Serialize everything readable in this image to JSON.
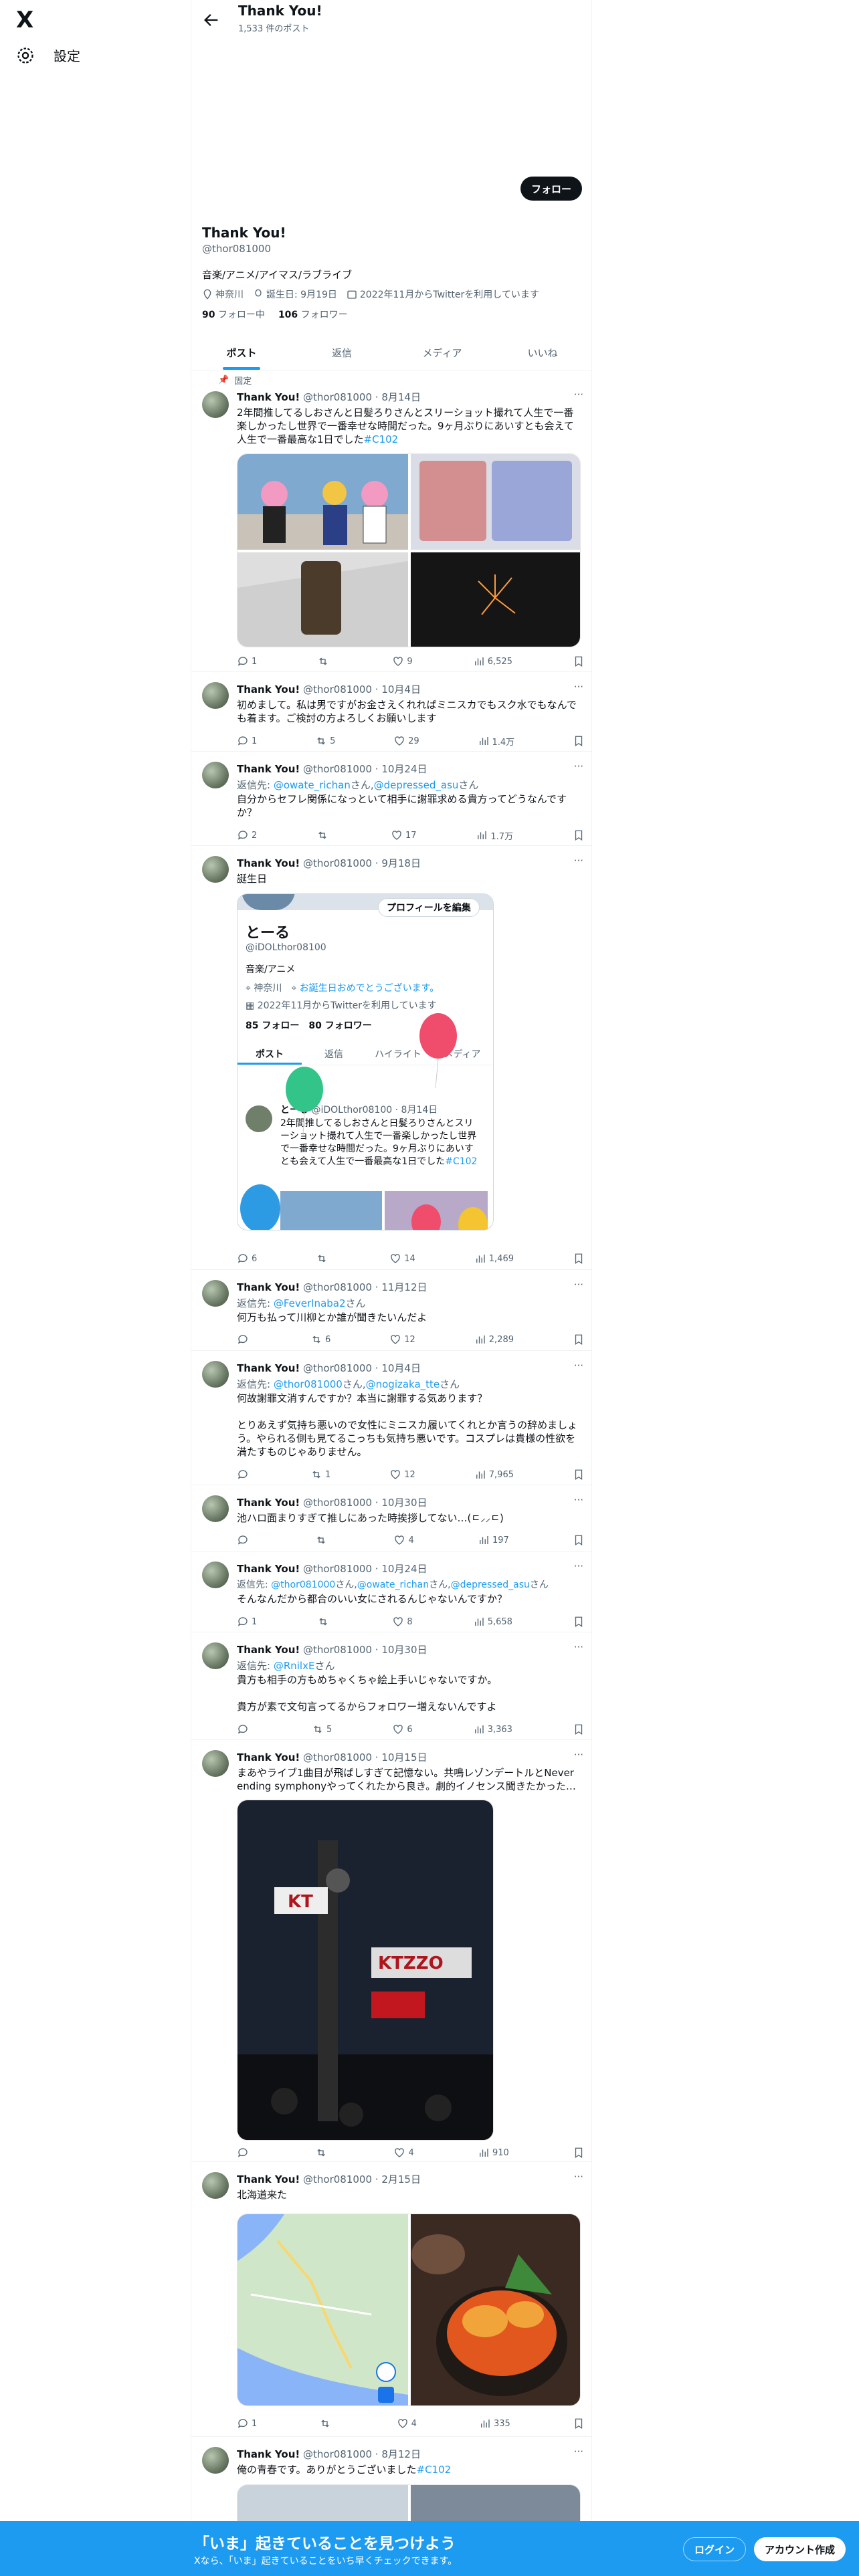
{
  "nav": {
    "logo": "X",
    "settings_label": "設定"
  },
  "header": {
    "name": "Thank You!",
    "post_count": "1,533 件のポスト"
  },
  "profile": {
    "follow_button": "フォロー",
    "name": "Thank You!",
    "handle": "@thor081000",
    "bio": "音楽/アニメ/アイマス/ラブライブ",
    "location": "神奈川",
    "birthday": "誕生日: 9月19日",
    "joined": "2022年11月からTwitterを利用しています",
    "following_count": "90",
    "following_label": "フォロー中",
    "followers_count": "106",
    "followers_label": "フォロワー"
  },
  "tabs": [
    "ポスト",
    "返信",
    "メディア",
    "いいね"
  ],
  "pinned_label": "固定",
  "tweets": [
    {
      "name": "Thank You!",
      "handle": "@thor081000",
      "date": "8月14日",
      "text": "2年間推してるしおさんと日髪ろりさんとスリーショット撮れて人生で一番楽しかったし世界で一番幸せな時間だった。9ヶ月ぶりにあいすとも会えて人生で一番最高な1日でした",
      "hashtag": "#C102",
      "reply": "1",
      "retweet": "",
      "like": "9",
      "views": "6,525"
    },
    {
      "name": "Thank You!",
      "handle": "@thor081000",
      "date": "10月4日",
      "text": "初めまして。私は男ですがお金さえくれればミニスカでもスク水でもなんでも着ます。ご検討の方よろしくお願いします",
      "reply": "1",
      "retweet": "5",
      "like": "29",
      "views": "1.4万"
    },
    {
      "name": "Thank You!",
      "handle": "@thor081000",
      "date": "10月24日",
      "reply_prefix": "返信先: ",
      "reply_to1": "@owate_richan",
      "reply_mid": "さん,",
      "reply_to2": "@depressed_asu",
      "reply_suffix": "さん",
      "text": "自分からセフレ関係になっといて相手に謝罪求める貴方ってどうなんですか？",
      "reply": "2",
      "retweet": "",
      "like": "17",
      "views": "1.7万"
    },
    {
      "name": "Thank You!",
      "handle": "@thor081000",
      "date": "9月18日",
      "text": "誕生日",
      "reply": "6",
      "retweet": "",
      "like": "14",
      "views": "1,469"
    },
    {
      "name": "Thank You!",
      "handle": "@thor081000",
      "date": "11月12日",
      "reply_prefix": "返信先: ",
      "reply_to1": "@FeverInaba2",
      "reply_suffix": "さん",
      "text": "何万も払って川柳とか誰が聞きたいんだよ",
      "reply": "",
      "retweet": "6",
      "like": "12",
      "views": "2,289"
    },
    {
      "name": "Thank You!",
      "handle": "@thor081000",
      "date": "10月4日",
      "reply_prefix": "返信先: ",
      "reply_to1": "@thor081000",
      "reply_mid": "さん,",
      "reply_to2": "@nogizaka_tte",
      "reply_suffix": "さん",
      "text": "何故謝罪文消すんですか？本当に謝罪する気あります？\n\nとりあえず気持ち悪いので女性にミニスカ履いてくれとか言うの辞めましょう。やられる側も見てるこっちも気持ち悪いです。コスプレは貴様の性欲を満たすものじゃありません。",
      "reply": "",
      "retweet": "1",
      "like": "12",
      "views": "7,965"
    },
    {
      "name": "Thank You!",
      "handle": "@thor081000",
      "date": "10月30日",
      "text": "池ハロ面まりすぎて推しにあった時挨拶してない…(ㄷ⸝⸝ㄷ)",
      "reply": "",
      "retweet": "",
      "like": "4",
      "views": "197"
    },
    {
      "name": "Thank You!",
      "handle": "@thor081000",
      "date": "10月24日",
      "reply_prefix": "返信先: ",
      "reply_to1": "@thor081000",
      "reply_mid": "さん,",
      "reply_to2": "@owate_richan",
      "reply_mid2": "さん,",
      "reply_to3": "@depressed_asu",
      "reply_suffix": "さん",
      "text": "そんなんだから都合のいい女にされるんじゃないんですか？",
      "reply": "1",
      "retweet": "",
      "like": "8",
      "views": "5,658"
    },
    {
      "name": "Thank You!",
      "handle": "@thor081000",
      "date": "10月30日",
      "reply_prefix": "返信先: ",
      "reply_to1": "@RnilxE",
      "reply_suffix": "さん",
      "text": "貴方も相手の方もめちゃくちゃ絵上手いじゃないですか。\n\n貴方が素で文句言ってるからフォロワー増えないんですよ",
      "reply": "",
      "retweet": "5",
      "like": "6",
      "views": "3,363"
    },
    {
      "name": "Thank You!",
      "handle": "@thor081000",
      "date": "10月15日",
      "text": "まあやライブ1曲目が飛ばしすぎて記憶ない。共鳴レゾンデートルとNever ending symphonyやってくれたから良き。劇的イノセンス聞きたかった…",
      "reply": "",
      "retweet": "",
      "like": "4",
      "views": "910"
    },
    {
      "name": "Thank You!",
      "handle": "@thor081000",
      "date": "2月15日",
      "text": "北海道来た",
      "reply": "1",
      "retweet": "",
      "like": "4",
      "views": "335"
    },
    {
      "name": "Thank You!",
      "handle": "@thor081000",
      "date": "8月12日",
      "text": "俺の青春です。ありがとうございました",
      "hashtag": "#C102"
    }
  ],
  "embed": {
    "edit_button": "プロフィールを編集",
    "name": "とーる",
    "handle": "@iDOLthor08100",
    "bio": "音楽/アニメ",
    "location": "神奈川",
    "birthday_msg": "お誕生日おめでとうございます。",
    "joined": "2022年11月からTwitterを利用しています",
    "following": "85 フォロー",
    "followers": "80 フォロワー",
    "tabs": [
      "ポスト",
      "返信",
      "ハイライト",
      "メディア"
    ],
    "tweet_name": "とーる",
    "tweet_handle": "@iDOLthor08100",
    "tweet_date": "8月14日",
    "tweet_text": "2年間推してるしおさんと日髪ろりさんとスリーショット撮れて人生で一番楽しかったし世界で一番幸せな時間だった。9ヶ月ぶりにあいすとも会えて人生で一番最高な1日でした",
    "hashtag": "#C102"
  },
  "cta": {
    "title": "「いま」起きていることを見つけよう",
    "subtitle": "Xなら、「いま」起きていることをいち早くチェックできます。",
    "login": "ログイン",
    "signup": "アカウント作成"
  },
  "sign_texts": {
    "kt": "KT",
    "ktzzo": "KTZZO"
  },
  "colors": {
    "accent": "#1d9bf0",
    "text": "#0f1419",
    "muted": "#536471"
  }
}
